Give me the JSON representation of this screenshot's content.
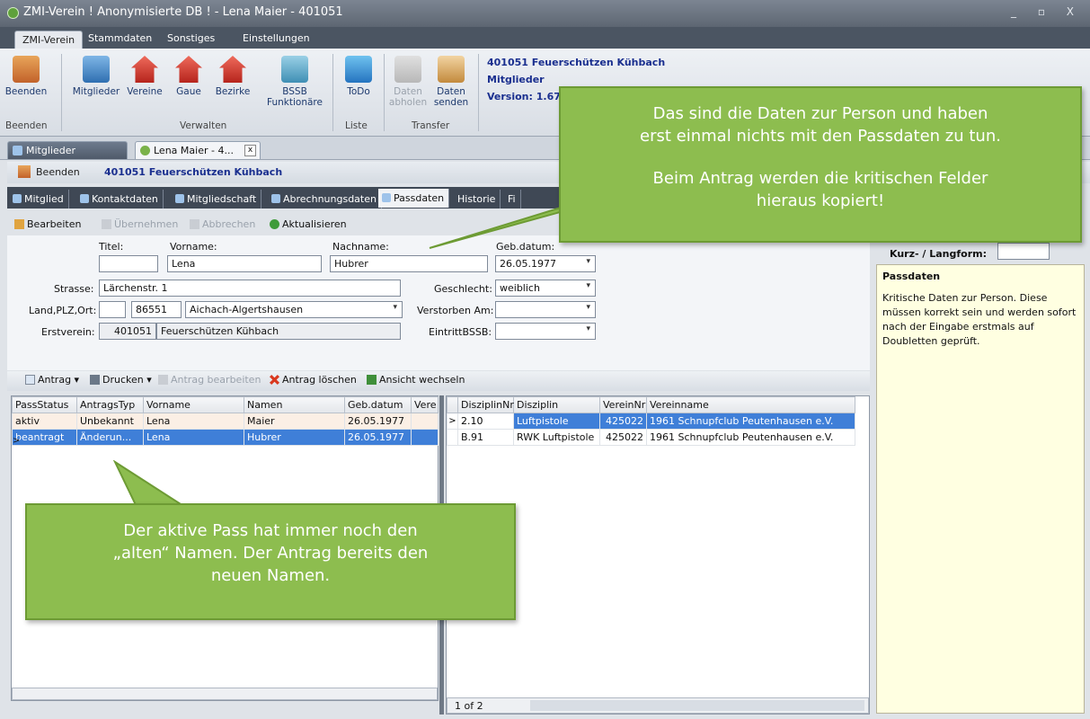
{
  "window": {
    "title": "ZMI-Verein  ! Anonymisierte DB !  - Lena Maier - 401051",
    "controls": "_ ▫ X"
  },
  "ribbon_tabs": [
    "ZMI-Verein",
    "Stammdaten",
    "Sonstiges",
    "Einstellungen"
  ],
  "ribbon_buttons": {
    "beenden": "Beenden",
    "mitglieder": "Mitglieder",
    "vereine": "Vereine",
    "gaue": "Gaue",
    "bezirke": "Bezirke",
    "bssb1": "BSSB",
    "bssb2": "Funktionäre",
    "todo": "ToDo",
    "abholen1": "Daten",
    "abholen2": "abholen",
    "senden1": "Daten",
    "senden2": "senden"
  },
  "ribbon_groups": {
    "beenden": "Beenden",
    "verwalten": "Verwalten",
    "liste": "Liste",
    "transfer": "Transfer"
  },
  "info": {
    "line1": "401051 Feuerschützen Kühbach",
    "line2": "Mitglieder",
    "line3": "Version: 1.67"
  },
  "doc_tabs": {
    "tab1": "Mitglieder",
    "tab2": "Lena Maier - 4...",
    "close": "x"
  },
  "crumb": {
    "beenden": "Beenden",
    "verein": "401051  Feuerschützen Kühbach"
  },
  "sub_tabs": [
    "Mitglied",
    "Kontaktdaten",
    "Mitgliedschaft",
    "Abrechnungsdaten",
    "Passdaten",
    "Historie",
    "Fi"
  ],
  "toolbar1": {
    "bearbeiten": "Bearbeiten",
    "uebernehmen": "Übernehmen",
    "abbrechen": "Abbrechen",
    "aktualisieren": "Aktualisieren"
  },
  "form": {
    "titel_label": "Titel:",
    "vorname_label": "Vorname:",
    "nachname_label": "Nachname:",
    "gebdatum_label": "Geb.datum:",
    "titel": "",
    "vorname": "Lena",
    "nachname": "Hubrer",
    "gebdatum": "26.05.1977",
    "strasse_label": "Strasse:",
    "strasse": "Lärchenstr. 1",
    "geschlecht_label": "Geschlecht:",
    "geschlecht": "weiblich",
    "land_label": "Land,PLZ,Ort:",
    "land": "",
    "plz": "86551",
    "ort": "Aichach-Algertshausen",
    "verstorben_label": "Verstorben Am:",
    "verstorben": "",
    "erstverein_label": "Erstverein:",
    "erstverein_nr": "401051",
    "erstverein_name": "Feuerschützen Kühbach",
    "eintritt_label": "EintrittBSSB:",
    "eintritt": "",
    "kurz_label": "Kurz- / Langform:"
  },
  "toolbar2": {
    "antrag": "Antrag",
    "drucken": "Drucken",
    "antrag_bearbeiten": "Antrag bearbeiten",
    "antrag_loeschen": "Antrag löschen",
    "ansicht": "Ansicht wechseln"
  },
  "grid1": {
    "headers": [
      "PassStatus",
      "AntragsTyp",
      "Vorname",
      "Namen",
      "Geb.datum",
      "Vere"
    ],
    "rows": [
      [
        "aktiv",
        "Unbekannt",
        "Lena",
        "Maier",
        "26.05.1977",
        ""
      ],
      [
        "beantragt",
        "Änderun...",
        "Lena",
        "Hubrer",
        "26.05.1977",
        ""
      ]
    ]
  },
  "grid2": {
    "headers": [
      "DisziplinNr",
      "Disziplin",
      "VereinNr",
      "Vereinname"
    ],
    "rows": [
      [
        "2.10",
        "Luftpistole",
        "425022",
        "1961 Schnupfclub Peutenhausen e.V."
      ],
      [
        "B.91",
        "RWK Luftpistole",
        "425022",
        "1961 Schnupfclub Peutenhausen e.V."
      ]
    ],
    "pager": "1 of 2"
  },
  "help": {
    "title": "Passdaten",
    "text": "Kritische Daten zur Person. Diese müssen korrekt sein und werden sofort nach der Eingabe erstmals auf Doubletten geprüft."
  },
  "callout_top": {
    "line1": "Das sind die Daten zur Person und haben",
    "line2": "erst einmal nichts mit den Passdaten zu tun.",
    "line3": "Beim Antrag werden die kritischen Felder",
    "line4": "hieraus kopiert!"
  },
  "callout_bottom": {
    "line1": "Der aktive Pass hat immer noch den",
    "line2": "„alten“ Namen. Der Antrag bereits den",
    "line3": "neuen Namen."
  }
}
